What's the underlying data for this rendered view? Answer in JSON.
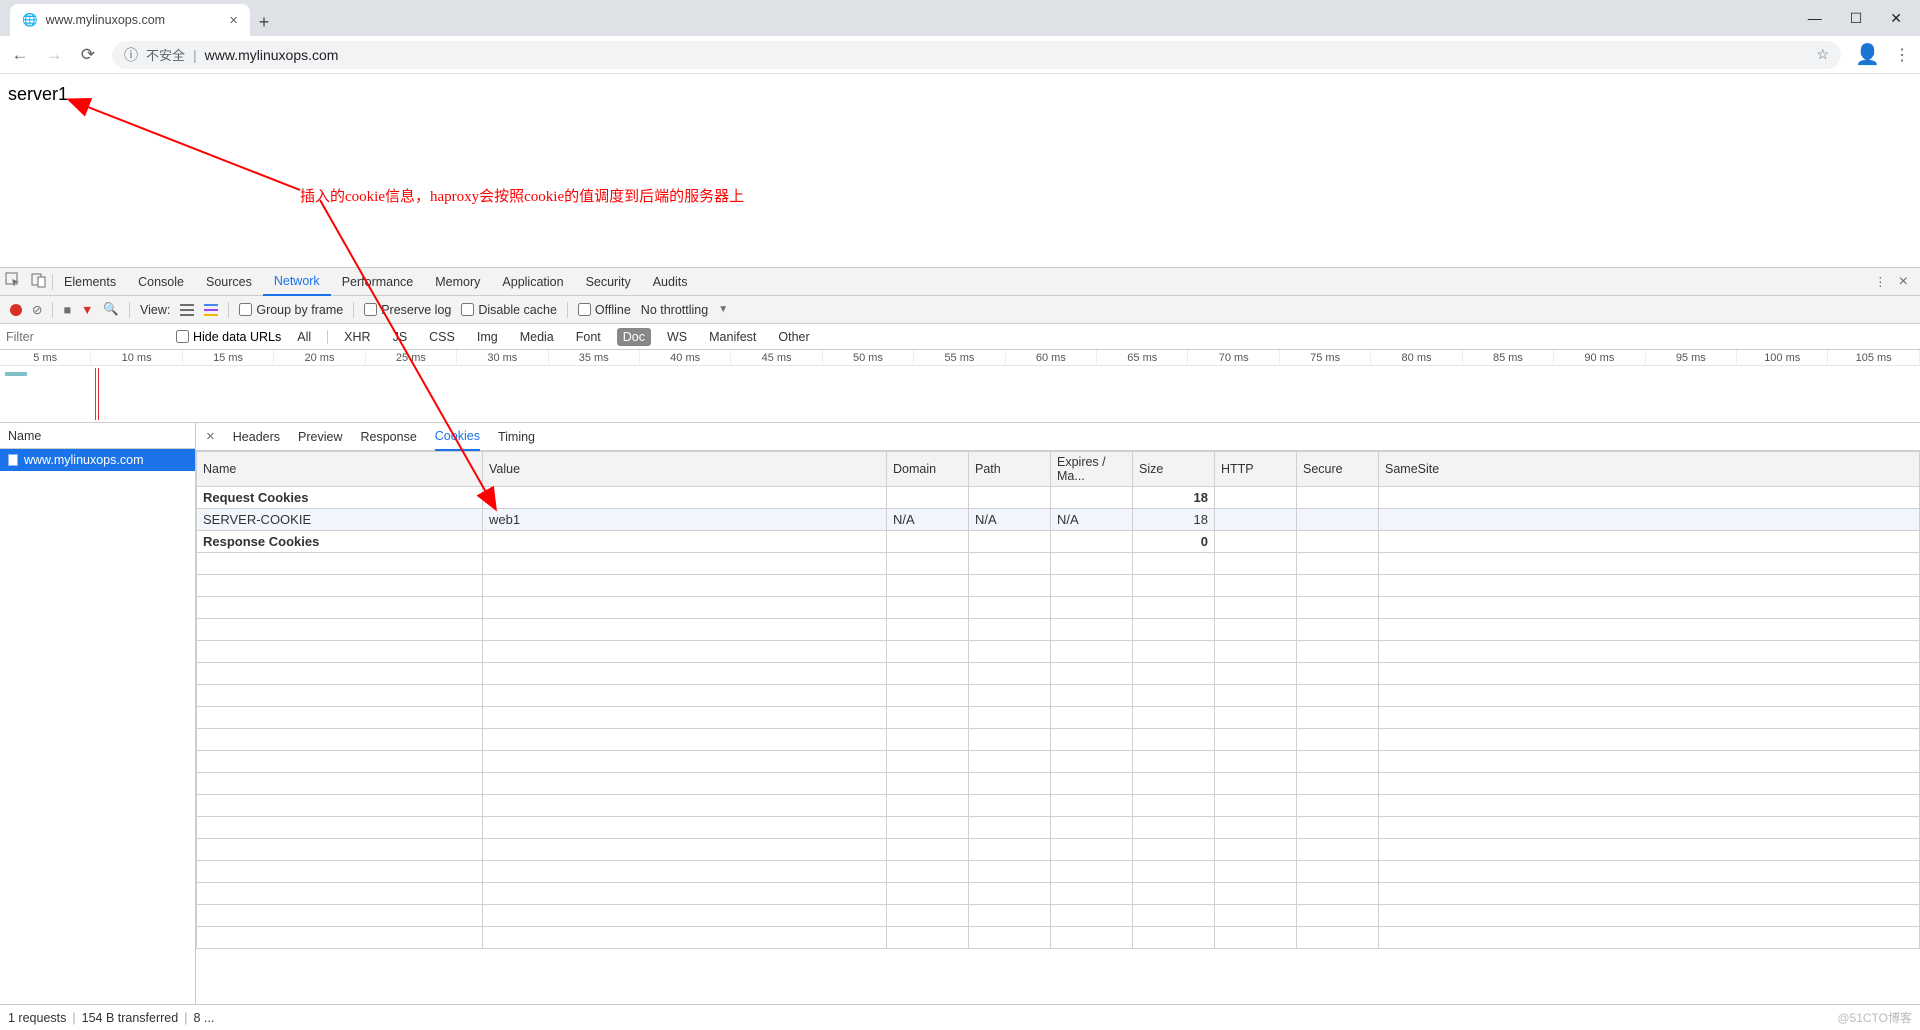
{
  "browser": {
    "tab_title": "www.mylinuxops.com",
    "security_label": "不安全",
    "url": "www.mylinuxops.com"
  },
  "page": {
    "body_text": "server1"
  },
  "annotation": {
    "text": "插入的cookie信息，haproxy会按照cookie的值调度到后端的服务器上"
  },
  "devtools": {
    "tabs": {
      "elements": "Elements",
      "console": "Console",
      "sources": "Sources",
      "network": "Network",
      "performance": "Performance",
      "memory": "Memory",
      "application": "Application",
      "security": "Security",
      "audits": "Audits"
    },
    "toolbar": {
      "view": "View:",
      "group": "Group by frame",
      "preserve": "Preserve log",
      "disable": "Disable cache",
      "offline": "Offline",
      "throttling": "No throttling"
    },
    "filter": {
      "placeholder": "Filter",
      "hide": "Hide data URLs",
      "all": "All",
      "xhr": "XHR",
      "js": "JS",
      "css": "CSS",
      "img": "Img",
      "media": "Media",
      "font": "Font",
      "doc": "Doc",
      "ws": "WS",
      "manifest": "Manifest",
      "other": "Other"
    },
    "timeline_ticks": [
      "5 ms",
      "10 ms",
      "15 ms",
      "20 ms",
      "25 ms",
      "30 ms",
      "35 ms",
      "40 ms",
      "45 ms",
      "50 ms",
      "55 ms",
      "60 ms",
      "65 ms",
      "70 ms",
      "75 ms",
      "80 ms",
      "85 ms",
      "90 ms",
      "95 ms",
      "100 ms",
      "105 ms"
    ],
    "left": {
      "header": "Name",
      "items": [
        "www.mylinuxops.com"
      ]
    },
    "detail_tabs": {
      "headers": "Headers",
      "preview": "Preview",
      "response": "Response",
      "cookies": "Cookies",
      "timing": "Timing"
    },
    "cookies": {
      "headers": {
        "name": "Name",
        "value": "Value",
        "domain": "Domain",
        "path": "Path",
        "expires": "Expires / Ma...",
        "size": "Size",
        "http": "HTTP",
        "secure": "Secure",
        "samesite": "SameSite"
      },
      "rows": [
        {
          "name": "Request Cookies",
          "value": "",
          "domain": "",
          "path": "",
          "expires": "",
          "size": "18",
          "http": "",
          "secure": "",
          "samesite": "",
          "bold": true
        },
        {
          "name": "SERVER-COOKIE",
          "value": "web1",
          "domain": "N/A",
          "path": "N/A",
          "expires": "N/A",
          "size": "18",
          "http": "",
          "secure": "",
          "samesite": "",
          "sel": true
        },
        {
          "name": "Response Cookies",
          "value": "",
          "domain": "",
          "path": "",
          "expires": "",
          "size": "0",
          "http": "",
          "secure": "",
          "samesite": "",
          "bold": true
        }
      ]
    }
  },
  "status": {
    "requests": "1 requests",
    "transferred": "154 B transferred",
    "extra": "8 ..."
  },
  "watermark": "@51CTO博客"
}
